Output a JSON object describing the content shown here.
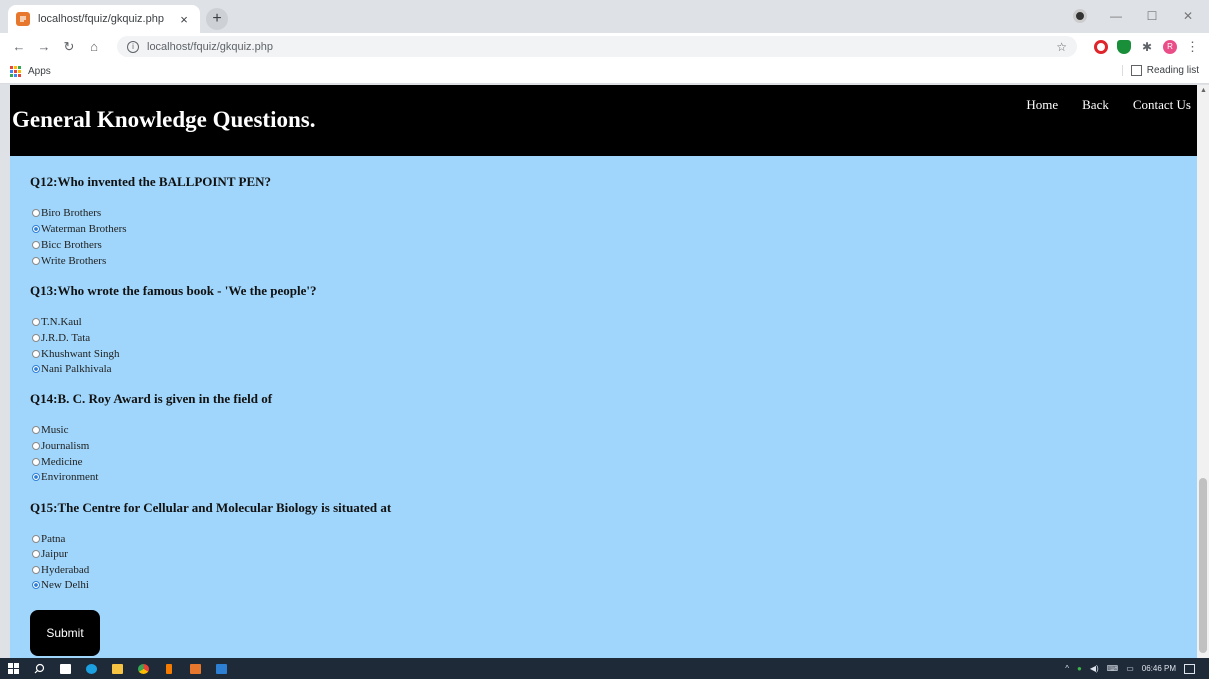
{
  "browser": {
    "tab_title": "localhost/fquiz/gkquiz.php",
    "tab_close": "×",
    "new_tab": "+",
    "url": "localhost/fquiz/gkquiz.php",
    "bookmark_apps": "Apps",
    "reading_list": "Reading list",
    "profile_initial": "R"
  },
  "site": {
    "title": "General Knowledge Questions.",
    "nav": [
      "Home",
      "Back",
      "Contact Us"
    ]
  },
  "questions": [
    {
      "text": "Q12:Who invented the BALLPOINT PEN?",
      "options": [
        "Biro Brothers",
        "Waterman Brothers",
        "Bicc Brothers",
        "Write Brothers"
      ],
      "selected": 1
    },
    {
      "text": "Q13:Who wrote the famous book - 'We the people'?",
      "options": [
        "T.N.Kaul",
        " J.R.D. Tata",
        "Khushwant Singh",
        "Nani Palkhivala"
      ],
      "selected": 3
    },
    {
      "text": "Q14:B. C. Roy Award is given in the field of",
      "options": [
        "Music",
        " Journalism",
        " Medicine",
        " Environment"
      ],
      "selected": 3
    },
    {
      "text": "Q15:The Centre for Cellular and Molecular Biology is situated at",
      "options": [
        "Patna",
        " Jaipur",
        " Hyderabad",
        "New Delhi"
      ],
      "selected": 3
    }
  ],
  "submit_label": "Submit",
  "taskbar": {
    "time": "06:46 PM"
  },
  "colors": {
    "page_bg": "#a0d6fb",
    "header_bg": "#000000",
    "radio_selected": "#2f7fd8"
  },
  "icons": {
    "taskbar": [
      "windows-start-icon",
      "search-icon",
      "store-icon",
      "edge-icon",
      "file-explorer-icon",
      "chrome-icon",
      "xampp-icon",
      "app-icon",
      "app-blue-icon"
    ]
  }
}
